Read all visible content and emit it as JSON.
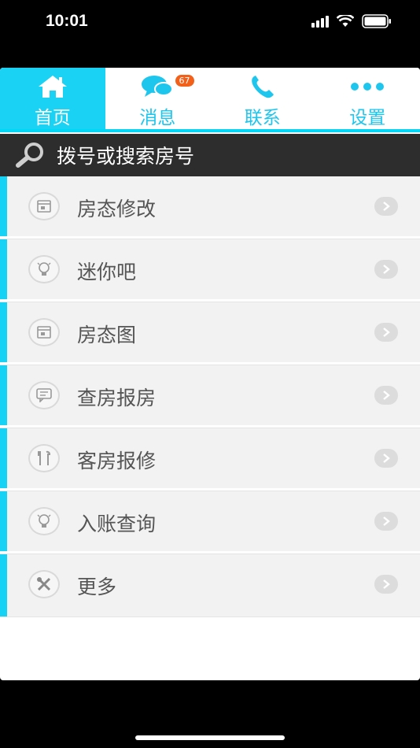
{
  "status": {
    "time": "10:01"
  },
  "tabs": [
    {
      "label": "首页",
      "icon": "home-icon",
      "active": true
    },
    {
      "label": "消息",
      "icon": "chat-bubbles-icon",
      "badge": "67"
    },
    {
      "label": "联系",
      "icon": "phone-icon"
    },
    {
      "label": "设置",
      "icon": "more-dots-icon"
    }
  ],
  "search": {
    "placeholder": "拨号或搜索房号"
  },
  "menu": [
    {
      "label": "房态修改",
      "icon": "room-card-icon"
    },
    {
      "label": "迷你吧",
      "icon": "lightbulb-icon"
    },
    {
      "label": "房态图",
      "icon": "room-card-icon"
    },
    {
      "label": "查房报房",
      "icon": "message-icon"
    },
    {
      "label": "客房报修",
      "icon": "tools-icon"
    },
    {
      "label": "入账查询",
      "icon": "lightbulb-icon"
    },
    {
      "label": "更多",
      "icon": "wrench-icon"
    }
  ],
  "colors": {
    "accent": "#1ad2f4",
    "badge": "#f2601a",
    "searchbar": "#2d2d2d"
  }
}
